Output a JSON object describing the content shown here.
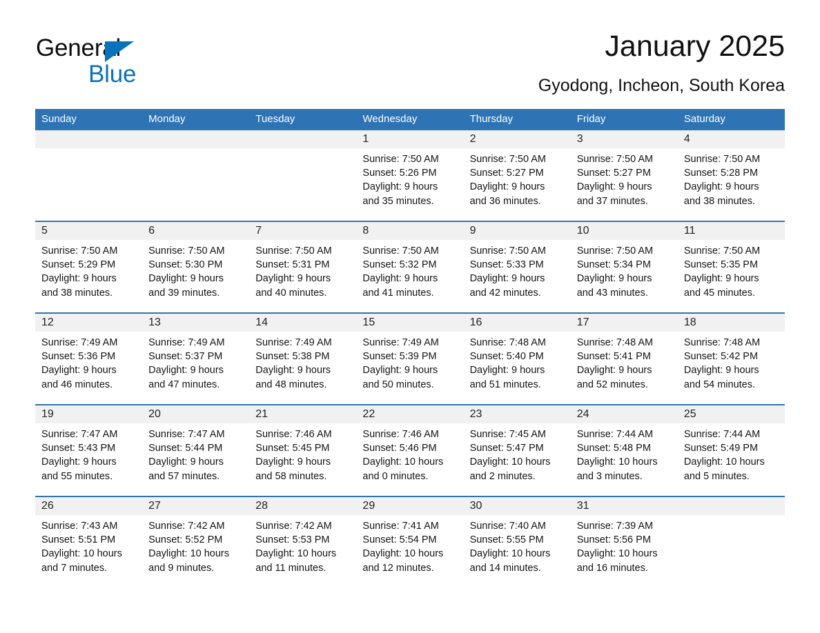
{
  "brand": {
    "name_part1": "General",
    "name_part2": "Blue"
  },
  "header": {
    "title": "January 2025",
    "location": "Gyodong, Incheon, South Korea"
  },
  "colors": {
    "header_blue": "#2e74b5",
    "brand_blue": "#0a72bd",
    "daynum_band": "#f1f1f1"
  },
  "weekdays": [
    "Sunday",
    "Monday",
    "Tuesday",
    "Wednesday",
    "Thursday",
    "Friday",
    "Saturday"
  ],
  "weeks": [
    [
      {
        "day": "",
        "sunrise": "",
        "sunset": "",
        "daylight_line1": "",
        "daylight_line2": ""
      },
      {
        "day": "",
        "sunrise": "",
        "sunset": "",
        "daylight_line1": "",
        "daylight_line2": ""
      },
      {
        "day": "",
        "sunrise": "",
        "sunset": "",
        "daylight_line1": "",
        "daylight_line2": ""
      },
      {
        "day": "1",
        "sunrise": "Sunrise: 7:50 AM",
        "sunset": "Sunset: 5:26 PM",
        "daylight_line1": "Daylight: 9 hours",
        "daylight_line2": "and 35 minutes."
      },
      {
        "day": "2",
        "sunrise": "Sunrise: 7:50 AM",
        "sunset": "Sunset: 5:27 PM",
        "daylight_line1": "Daylight: 9 hours",
        "daylight_line2": "and 36 minutes."
      },
      {
        "day": "3",
        "sunrise": "Sunrise: 7:50 AM",
        "sunset": "Sunset: 5:27 PM",
        "daylight_line1": "Daylight: 9 hours",
        "daylight_line2": "and 37 minutes."
      },
      {
        "day": "4",
        "sunrise": "Sunrise: 7:50 AM",
        "sunset": "Sunset: 5:28 PM",
        "daylight_line1": "Daylight: 9 hours",
        "daylight_line2": "and 38 minutes."
      }
    ],
    [
      {
        "day": "5",
        "sunrise": "Sunrise: 7:50 AM",
        "sunset": "Sunset: 5:29 PM",
        "daylight_line1": "Daylight: 9 hours",
        "daylight_line2": "and 38 minutes."
      },
      {
        "day": "6",
        "sunrise": "Sunrise: 7:50 AM",
        "sunset": "Sunset: 5:30 PM",
        "daylight_line1": "Daylight: 9 hours",
        "daylight_line2": "and 39 minutes."
      },
      {
        "day": "7",
        "sunrise": "Sunrise: 7:50 AM",
        "sunset": "Sunset: 5:31 PM",
        "daylight_line1": "Daylight: 9 hours",
        "daylight_line2": "and 40 minutes."
      },
      {
        "day": "8",
        "sunrise": "Sunrise: 7:50 AM",
        "sunset": "Sunset: 5:32 PM",
        "daylight_line1": "Daylight: 9 hours",
        "daylight_line2": "and 41 minutes."
      },
      {
        "day": "9",
        "sunrise": "Sunrise: 7:50 AM",
        "sunset": "Sunset: 5:33 PM",
        "daylight_line1": "Daylight: 9 hours",
        "daylight_line2": "and 42 minutes."
      },
      {
        "day": "10",
        "sunrise": "Sunrise: 7:50 AM",
        "sunset": "Sunset: 5:34 PM",
        "daylight_line1": "Daylight: 9 hours",
        "daylight_line2": "and 43 minutes."
      },
      {
        "day": "11",
        "sunrise": "Sunrise: 7:50 AM",
        "sunset": "Sunset: 5:35 PM",
        "daylight_line1": "Daylight: 9 hours",
        "daylight_line2": "and 45 minutes."
      }
    ],
    [
      {
        "day": "12",
        "sunrise": "Sunrise: 7:49 AM",
        "sunset": "Sunset: 5:36 PM",
        "daylight_line1": "Daylight: 9 hours",
        "daylight_line2": "and 46 minutes."
      },
      {
        "day": "13",
        "sunrise": "Sunrise: 7:49 AM",
        "sunset": "Sunset: 5:37 PM",
        "daylight_line1": "Daylight: 9 hours",
        "daylight_line2": "and 47 minutes."
      },
      {
        "day": "14",
        "sunrise": "Sunrise: 7:49 AM",
        "sunset": "Sunset: 5:38 PM",
        "daylight_line1": "Daylight: 9 hours",
        "daylight_line2": "and 48 minutes."
      },
      {
        "day": "15",
        "sunrise": "Sunrise: 7:49 AM",
        "sunset": "Sunset: 5:39 PM",
        "daylight_line1": "Daylight: 9 hours",
        "daylight_line2": "and 50 minutes."
      },
      {
        "day": "16",
        "sunrise": "Sunrise: 7:48 AM",
        "sunset": "Sunset: 5:40 PM",
        "daylight_line1": "Daylight: 9 hours",
        "daylight_line2": "and 51 minutes."
      },
      {
        "day": "17",
        "sunrise": "Sunrise: 7:48 AM",
        "sunset": "Sunset: 5:41 PM",
        "daylight_line1": "Daylight: 9 hours",
        "daylight_line2": "and 52 minutes."
      },
      {
        "day": "18",
        "sunrise": "Sunrise: 7:48 AM",
        "sunset": "Sunset: 5:42 PM",
        "daylight_line1": "Daylight: 9 hours",
        "daylight_line2": "and 54 minutes."
      }
    ],
    [
      {
        "day": "19",
        "sunrise": "Sunrise: 7:47 AM",
        "sunset": "Sunset: 5:43 PM",
        "daylight_line1": "Daylight: 9 hours",
        "daylight_line2": "and 55 minutes."
      },
      {
        "day": "20",
        "sunrise": "Sunrise: 7:47 AM",
        "sunset": "Sunset: 5:44 PM",
        "daylight_line1": "Daylight: 9 hours",
        "daylight_line2": "and 57 minutes."
      },
      {
        "day": "21",
        "sunrise": "Sunrise: 7:46 AM",
        "sunset": "Sunset: 5:45 PM",
        "daylight_line1": "Daylight: 9 hours",
        "daylight_line2": "and 58 minutes."
      },
      {
        "day": "22",
        "sunrise": "Sunrise: 7:46 AM",
        "sunset": "Sunset: 5:46 PM",
        "daylight_line1": "Daylight: 10 hours",
        "daylight_line2": "and 0 minutes."
      },
      {
        "day": "23",
        "sunrise": "Sunrise: 7:45 AM",
        "sunset": "Sunset: 5:47 PM",
        "daylight_line1": "Daylight: 10 hours",
        "daylight_line2": "and 2 minutes."
      },
      {
        "day": "24",
        "sunrise": "Sunrise: 7:44 AM",
        "sunset": "Sunset: 5:48 PM",
        "daylight_line1": "Daylight: 10 hours",
        "daylight_line2": "and 3 minutes."
      },
      {
        "day": "25",
        "sunrise": "Sunrise: 7:44 AM",
        "sunset": "Sunset: 5:49 PM",
        "daylight_line1": "Daylight: 10 hours",
        "daylight_line2": "and 5 minutes."
      }
    ],
    [
      {
        "day": "26",
        "sunrise": "Sunrise: 7:43 AM",
        "sunset": "Sunset: 5:51 PM",
        "daylight_line1": "Daylight: 10 hours",
        "daylight_line2": "and 7 minutes."
      },
      {
        "day": "27",
        "sunrise": "Sunrise: 7:42 AM",
        "sunset": "Sunset: 5:52 PM",
        "daylight_line1": "Daylight: 10 hours",
        "daylight_line2": "and 9 minutes."
      },
      {
        "day": "28",
        "sunrise": "Sunrise: 7:42 AM",
        "sunset": "Sunset: 5:53 PM",
        "daylight_line1": "Daylight: 10 hours",
        "daylight_line2": "and 11 minutes."
      },
      {
        "day": "29",
        "sunrise": "Sunrise: 7:41 AM",
        "sunset": "Sunset: 5:54 PM",
        "daylight_line1": "Daylight: 10 hours",
        "daylight_line2": "and 12 minutes."
      },
      {
        "day": "30",
        "sunrise": "Sunrise: 7:40 AM",
        "sunset": "Sunset: 5:55 PM",
        "daylight_line1": "Daylight: 10 hours",
        "daylight_line2": "and 14 minutes."
      },
      {
        "day": "31",
        "sunrise": "Sunrise: 7:39 AM",
        "sunset": "Sunset: 5:56 PM",
        "daylight_line1": "Daylight: 10 hours",
        "daylight_line2": "and 16 minutes."
      },
      {
        "day": "",
        "sunrise": "",
        "sunset": "",
        "daylight_line1": "",
        "daylight_line2": ""
      }
    ]
  ]
}
